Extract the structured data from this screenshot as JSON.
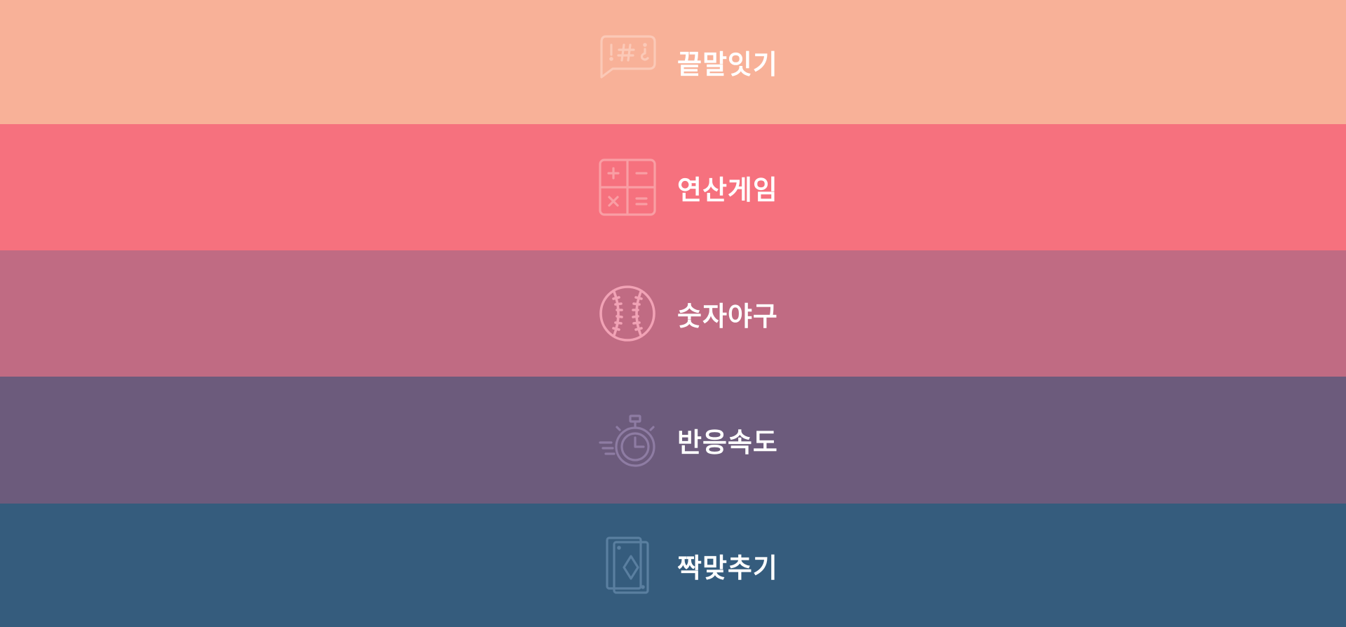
{
  "menu": {
    "items": [
      {
        "label": "끝말잇기",
        "icon": "speech-bubble-symbols-icon",
        "bg": "#f8b198",
        "icon_color": "#fbc9b7"
      },
      {
        "label": "연산게임",
        "icon": "calculator-icon",
        "bg": "#f6717e",
        "icon_color": "#f99ea4"
      },
      {
        "label": "숫자야구",
        "icon": "baseball-icon",
        "bg": "#c06b83",
        "icon_color": "#f1a2b5"
      },
      {
        "label": "반응속도",
        "icon": "stopwatch-icon",
        "bg": "#6c5b7c",
        "icon_color": "#8e7ca3"
      },
      {
        "label": "짝맞추기",
        "icon": "cards-icon",
        "bg": "#355c7d",
        "icon_color": "#5a7fa0"
      }
    ]
  }
}
